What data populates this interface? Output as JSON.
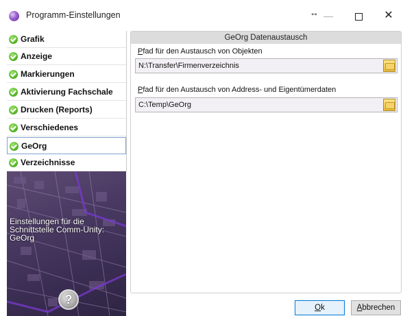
{
  "window": {
    "title": "Programm-Einstellungen",
    "resize_glyph": "↔",
    "min_glyph": "—",
    "close_glyph": "✕"
  },
  "nav": {
    "items": [
      {
        "label": "Grafik",
        "selected": false
      },
      {
        "label": "Anzeige",
        "selected": false
      },
      {
        "label": "Markierungen",
        "selected": false
      },
      {
        "label": "Aktivierung Fachschale",
        "selected": false
      },
      {
        "label": "Drucken (Reports)",
        "selected": false
      },
      {
        "label": "Verschiedenes",
        "selected": false
      },
      {
        "label": "GeOrg",
        "selected": true
      },
      {
        "label": "Verzeichnisse",
        "selected": false
      }
    ],
    "item_icon": "green-check-icon"
  },
  "side_panel": {
    "description": "Einstellungen für die Schnittstelle Comm-Unity: GeOrg",
    "help_glyph": "?"
  },
  "group": {
    "title": "GeOrg Datenaustausch",
    "objects": {
      "label_mnemonic": "P",
      "label_rest": "fad für den Austausch von Objekten",
      "value": "N:\\Transfer\\Firmenverzeichnis"
    },
    "address": {
      "label_mnemonic": "P",
      "label_rest": "fad für den Austausch von Address- und Eigentümerdaten",
      "value": "C:\\Temp\\GeOrg"
    },
    "folder_icon": "folder-icon"
  },
  "buttons": {
    "ok_mnemonic": "O",
    "ok_rest": "k",
    "cancel_mnemonic": "A",
    "cancel_rest": "bbrechen"
  },
  "colors": {
    "accent": "#0078d7",
    "selected_border": "#7fa3cf",
    "header_bg": "#dcdcdc",
    "input_bg": "#f3f0f5",
    "check_green": "#5dbb2c"
  }
}
